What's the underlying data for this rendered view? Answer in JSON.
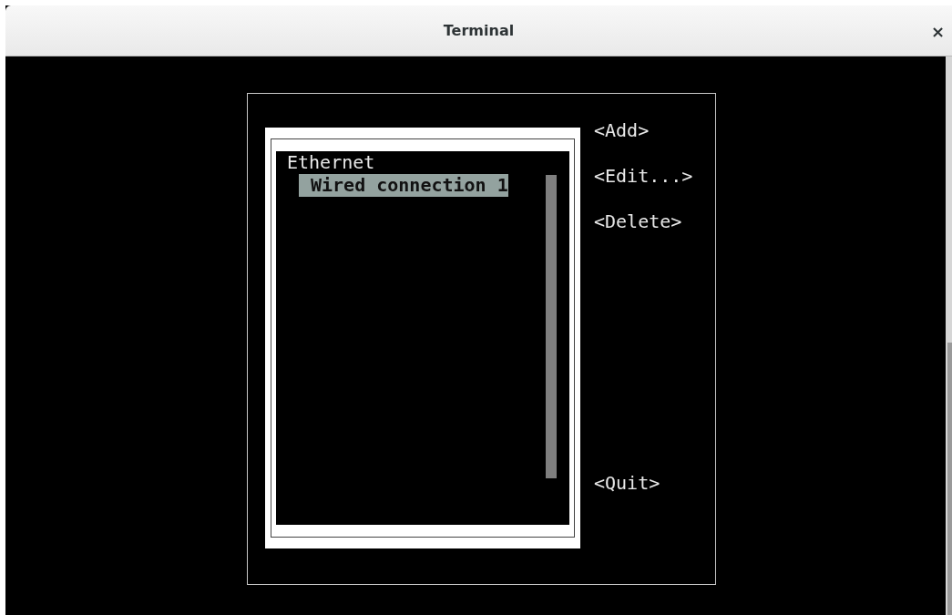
{
  "window": {
    "title": "Terminal",
    "close": "×"
  },
  "connection_list": {
    "items": [
      {
        "label": "Ethernet",
        "selected": false,
        "children": [
          {
            "label": "Wired connection 1",
            "selected": true
          }
        ]
      }
    ]
  },
  "buttons": [
    "<Add>",
    "<Edit...>",
    "<Delete>",
    "<Quit>"
  ]
}
